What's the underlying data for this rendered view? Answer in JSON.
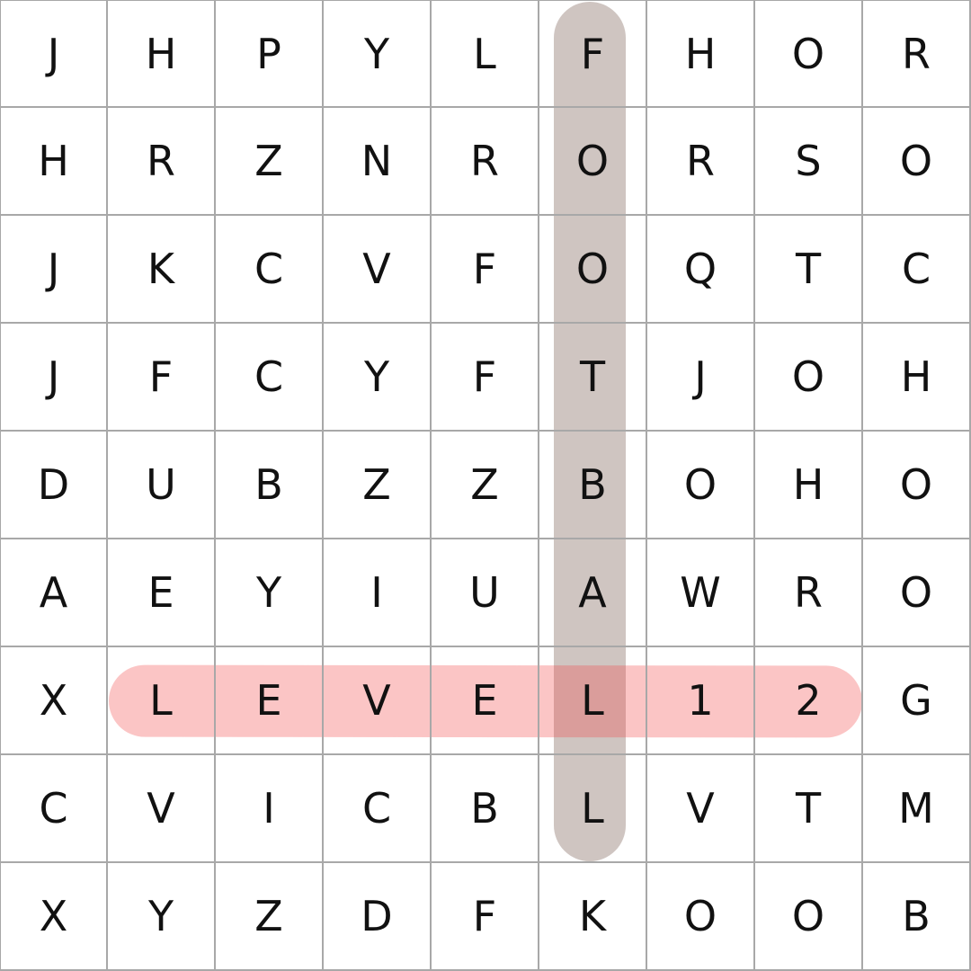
{
  "grid": {
    "rows": [
      [
        "J",
        "H",
        "P",
        "Y",
        "L",
        "F",
        "H",
        "O",
        "R"
      ],
      [
        "H",
        "R",
        "Z",
        "N",
        "R",
        "O",
        "R",
        "S",
        "O"
      ],
      [
        "J",
        "K",
        "C",
        "V",
        "F",
        "O",
        "Q",
        "T",
        "C"
      ],
      [
        "J",
        "F",
        "C",
        "Y",
        "F",
        "T",
        "J",
        "O",
        "H"
      ],
      [
        "D",
        "U",
        "B",
        "Z",
        "Z",
        "B",
        "O",
        "H",
        "O"
      ],
      [
        "A",
        "E",
        "Y",
        "I",
        "U",
        "A",
        "W",
        "R",
        "O"
      ],
      [
        "X",
        "L",
        "E",
        "V",
        "E",
        "L",
        "1",
        "2",
        "G"
      ],
      [
        "C",
        "V",
        "I",
        "C",
        "B",
        "L",
        "V",
        "T",
        "M"
      ],
      [
        "X",
        "Y",
        "Z",
        "D",
        "F",
        "K",
        "O",
        "O",
        "B"
      ]
    ]
  },
  "found_words": [
    {
      "word": "FOOTBALL",
      "color": "#6b4a3d"
    },
    {
      "word": "LEVEL12",
      "color": "#f24b4b"
    }
  ],
  "colors": {
    "grid_line": "#a8a8a8",
    "text": "#111111",
    "background": "#ffffff"
  }
}
